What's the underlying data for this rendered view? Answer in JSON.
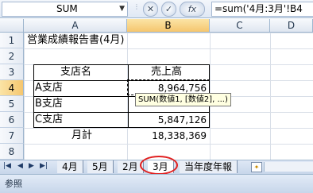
{
  "formula_bar": {
    "name_box": "SUM",
    "cancel_glyph": "✕",
    "enter_glyph": "✓",
    "fx_glyph": "fx",
    "formula": "=sum('4月:3月'!B4"
  },
  "columns": [
    "A",
    "B",
    "C",
    "D"
  ],
  "rows": [
    "1",
    "2",
    "3",
    "4",
    "5",
    "6",
    "7",
    "8"
  ],
  "cells": {
    "a1": "営業成績報告書(4月)",
    "a3": "支店名",
    "b3": "売上高",
    "a4": "A支店",
    "b4": "8,964,756",
    "a5": "B支店",
    "a6": "C支店",
    "b6": "5,847,126",
    "a7": "月計",
    "b7": "18,338,369"
  },
  "tooltip": "SUM(数値1, [数値2], ...)",
  "sheet_tabs": [
    "4月",
    "5月",
    "2月",
    "3月",
    "当年度年報"
  ],
  "active_tab": "3月",
  "status": "参照",
  "colors": {
    "highlight_circle": "#e02020",
    "header_selected": "#f5c66e"
  }
}
